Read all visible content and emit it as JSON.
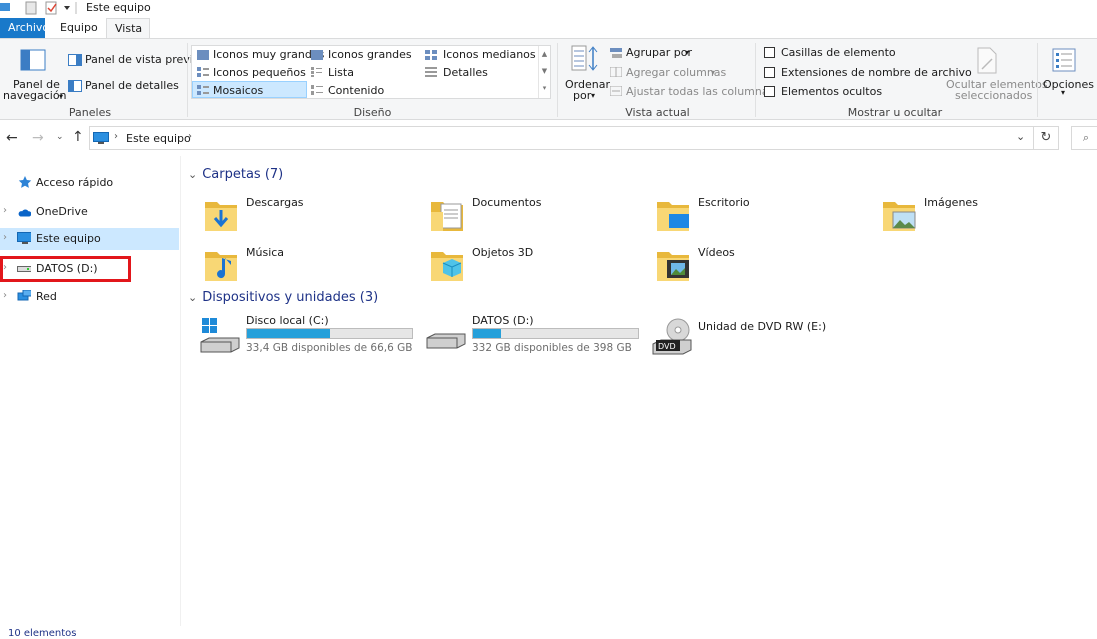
{
  "window": {
    "title": "Este equipo"
  },
  "tabs": [
    {
      "label": "Archivo"
    },
    {
      "label": "Equipo"
    },
    {
      "label": "Vista"
    }
  ],
  "ribbon": {
    "paneles": {
      "nav_pane_label_line1": "Panel de",
      "nav_pane_label_line2": "navegación",
      "preview_pane": "Panel de vista previa",
      "details_pane": "Panel de detalles",
      "group_label": "Paneles"
    },
    "diseno": {
      "items": [
        "Iconos muy grandes",
        "Iconos grandes",
        "Iconos medianos",
        "Iconos pequeños",
        "Lista",
        "Detalles",
        "Mosaicos",
        "Contenido"
      ],
      "selected": "Mosaicos",
      "group_label": "Diseño"
    },
    "vista_actual": {
      "sort_line1": "Ordenar",
      "sort_line2": "por",
      "group_by": "Agrupar por",
      "add_columns": "Agregar columnas",
      "fit_columns": "Ajustar todas las columnas",
      "group_label": "Vista actual"
    },
    "mostrar": {
      "checkbox1": "Casillas de elemento",
      "checkbox2": "Extensiones de nombre de archivo",
      "checkbox3": "Elementos ocultos",
      "hide_selected_line1": "Ocultar elementos",
      "hide_selected_line2": "seleccionados",
      "group_label": "Mostrar u ocultar"
    },
    "options_label": "Opciones"
  },
  "address": {
    "path": "Este equipo"
  },
  "sidebar": {
    "items": [
      {
        "label": "Acceso rápido"
      },
      {
        "label": "OneDrive"
      },
      {
        "label": "Este equipo"
      },
      {
        "label": "DATOS (D:)"
      },
      {
        "label": "Red"
      }
    ]
  },
  "folders_section": {
    "title": "Carpetas (7)"
  },
  "folders": [
    {
      "label": "Descargas"
    },
    {
      "label": "Documentos"
    },
    {
      "label": "Escritorio"
    },
    {
      "label": "Imágenes"
    },
    {
      "label": "Música"
    },
    {
      "label": "Objetos 3D"
    },
    {
      "label": "Vídeos"
    }
  ],
  "devices_section": {
    "title": "Dispositivos y unidades (3)"
  },
  "drives": [
    {
      "label": "Disco local (C:)",
      "space": "33,4 GB disponibles de 66,6 GB",
      "used_fraction": 0.5
    },
    {
      "label": "DATOS (D:)",
      "space": "332 GB disponibles de 398 GB",
      "used_fraction": 0.17
    },
    {
      "label": "Unidad de DVD RW (E:)"
    }
  ],
  "status": {
    "text": "10 elementos"
  },
  "colors": {
    "accent": "#1979ca",
    "selection": "#cce8ff",
    "highlight_box": "#e2161b",
    "drive_fill": "#26a0da",
    "section_title": "#1e3287"
  }
}
